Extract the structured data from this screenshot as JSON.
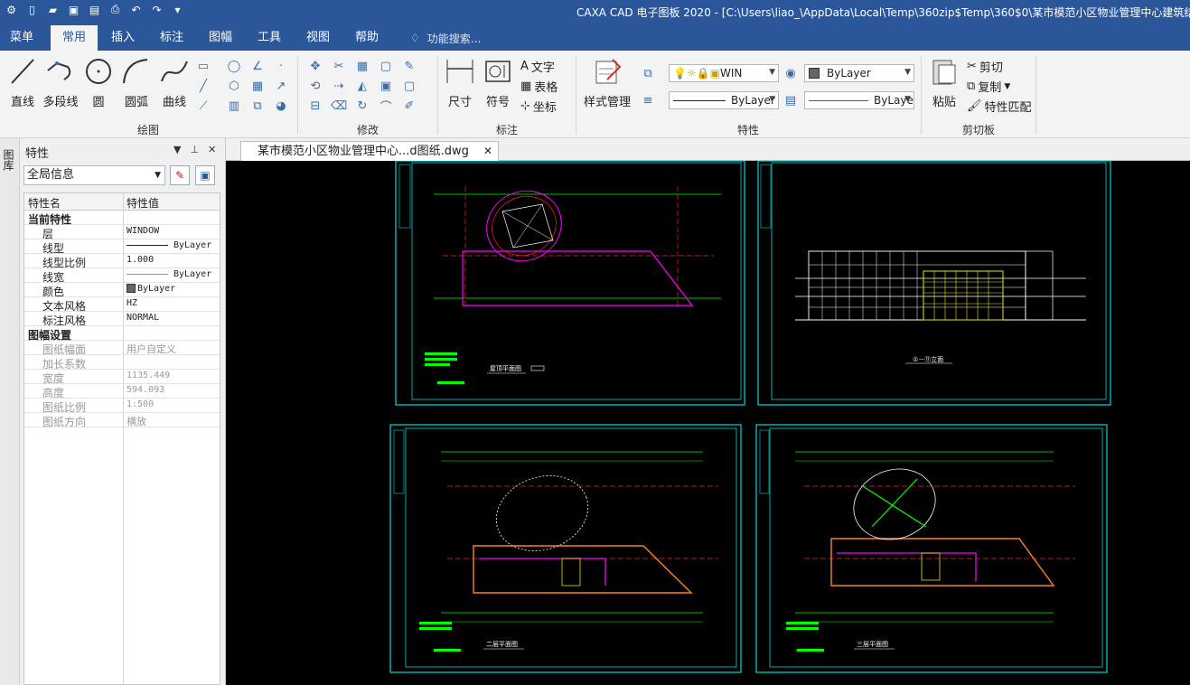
{
  "titlebar": {
    "title": "CAXA CAD 电子图板 2020 - [C:\\Users\\liao_\\AppData\\Local\\Temp\\360zip$Temp\\360$0\\某市模范小区物业管理中心建筑结构设"
  },
  "menu": {
    "items": [
      "菜单",
      "常用",
      "插入",
      "标注",
      "图幅",
      "工具",
      "视图",
      "帮助"
    ],
    "active": "常用",
    "search_placeholder": "功能搜索..."
  },
  "ribbon": {
    "draw": {
      "label": "绘图",
      "buttons": [
        "直线",
        "多段线",
        "圆",
        "圆弧",
        "曲线"
      ]
    },
    "modify": {
      "label": "修改"
    },
    "annotate": {
      "label": "标注",
      "buttons": [
        "尺寸",
        "符号"
      ],
      "small": [
        "文字",
        "表格",
        "坐标"
      ]
    },
    "properties": {
      "label": "特性",
      "style_manager": "样式管理",
      "layer_value": "WIN",
      "color_value": "ByLayer",
      "linetype_value": "ByLayer",
      "lineweight_value": "ByLaye"
    },
    "clipboard": {
      "label": "剪切板",
      "paste": "粘贴",
      "cut": "剪切",
      "copy": "复制",
      "match": "特性匹配"
    }
  },
  "panel": {
    "title": "特性",
    "side_tab": "图库",
    "scope": "全局信息",
    "col_name": "特性名",
    "col_value": "特性值",
    "groups": [
      {
        "name": "当前特性",
        "rows": [
          {
            "k": "层",
            "v": "WINDOW"
          },
          {
            "k": "线型",
            "v": "ByLayer"
          },
          {
            "k": "线型比例",
            "v": "1.000"
          },
          {
            "k": "线宽",
            "v": "ByLayer"
          },
          {
            "k": "颜色",
            "v": "ByLayer"
          },
          {
            "k": "文本风格",
            "v": "HZ"
          },
          {
            "k": "标注风格",
            "v": "NORMAL"
          }
        ]
      },
      {
        "name": "图幅设置",
        "rows": [
          {
            "k": "图纸幅面",
            "v": "用户自定义"
          },
          {
            "k": "加长系数",
            "v": ""
          },
          {
            "k": "宽度",
            "v": "1135.449"
          },
          {
            "k": "高度",
            "v": "594.093"
          },
          {
            "k": "图纸比例",
            "v": "1:500"
          },
          {
            "k": "图纸方向",
            "v": "横放"
          }
        ]
      }
    ]
  },
  "document": {
    "tab_label": "某市模范小区物业管理中心...d图纸.dwg"
  },
  "drawings": {
    "roof_plan": "屋顶平面图",
    "elevation": "①－⑪立面",
    "second_floor": "二层平面图",
    "third_floor": "三层平面图"
  },
  "colors": {
    "title_bar": "#2b579a",
    "canvas": "#000000",
    "frame": "#00d8d8",
    "axis_red": "#ff2020",
    "wall_magenta": "#ff00ff",
    "green_lines": "#00ff00",
    "yellow_fill": "#e8e800"
  }
}
